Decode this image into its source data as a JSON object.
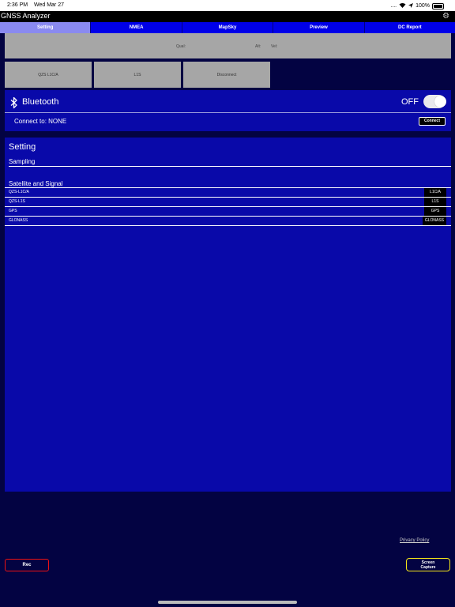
{
  "status_bar": {
    "time": "2:36 PM",
    "date": "Wed Mar 27",
    "signal": "....",
    "battery": "100%"
  },
  "app": {
    "title": "GNSS Analyzer"
  },
  "tabs": [
    {
      "label": "Setting",
      "active": true
    },
    {
      "label": "NMEA"
    },
    {
      "label": "MapSky"
    },
    {
      "label": "Preview"
    },
    {
      "label": "DC Report"
    }
  ],
  "info": {
    "qual": "Qual:",
    "alt": "Alt:",
    "vel": "Vel:"
  },
  "buttons": {
    "qzs_l1ca": "QZS L1C/A",
    "l1s": "L1S",
    "disconnect": "Disconnect"
  },
  "bluetooth": {
    "label": "Bluetooth",
    "state": "OFF",
    "connect_to": "Connect to: NONE",
    "connect_button": "Connect"
  },
  "setting": {
    "title": "Setting",
    "sampling": "Sampling",
    "satellite_and_signal": "Satellite and Signal",
    "rows": [
      {
        "name": "QZS-L1C/A",
        "value": "L1C/A"
      },
      {
        "name": "QZS-L1S",
        "value": "L1S"
      },
      {
        "name": "GPS",
        "value": "GPS"
      },
      {
        "name": "GLONASS",
        "value": "GLONASS"
      }
    ]
  },
  "footer": {
    "privacy": "Privacy Policy",
    "rec": "Rec",
    "capture_line1": "Screen",
    "capture_line2": "Capture"
  },
  "colors": {
    "background": "#030342",
    "panel": "#0909a9",
    "tab_bar": "#0000e8",
    "rec_border": "#e11111",
    "capture_border": "#f4e619"
  }
}
